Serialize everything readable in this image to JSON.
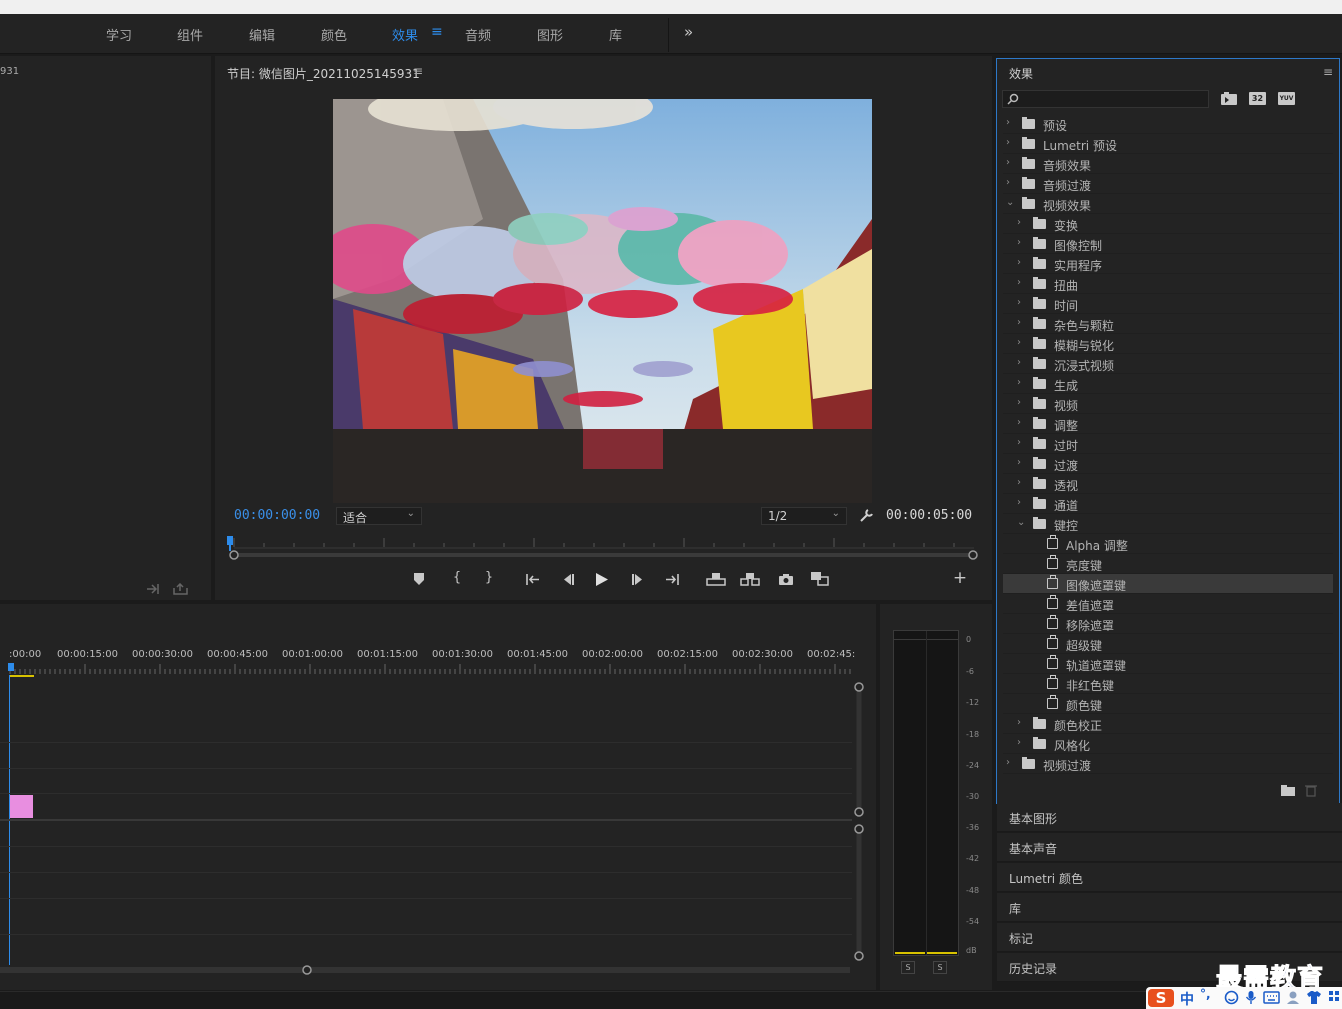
{
  "workspaces": {
    "items": [
      "学习",
      "组件",
      "编辑",
      "颜色",
      "效果",
      "音频",
      "图形",
      "库"
    ],
    "active_index": 4,
    "overflow": "»",
    "active_menu_glyph": "≡"
  },
  "source_panel": {
    "title_fragment": "931"
  },
  "program_monitor": {
    "title": "节目: 微信图片_20211025145931",
    "menu_glyph": "≡",
    "current_timecode": "00:00:00:00",
    "fit_select": "适合",
    "resolution_select": "1/2",
    "duration_timecode": "00:00:05:00",
    "add_glyph": "+"
  },
  "timeline": {
    "ruler_labels": [
      ":00:00",
      "00:00:15:00",
      "00:00:30:00",
      "00:00:45:00",
      "00:01:00:00",
      "00:01:15:00",
      "00:01:30:00",
      "00:01:45:00",
      "00:02:00:00",
      "00:02:15:00",
      "00:02:30:00",
      "00:02:45:"
    ]
  },
  "audio_meter": {
    "db_labels": [
      "0",
      "-6",
      "-12",
      "-18",
      "-24",
      "-30",
      "-36",
      "-42",
      "-48",
      "-54",
      "dB"
    ],
    "solo_labels": [
      "S",
      "S"
    ]
  },
  "effects_panel": {
    "title": "效果",
    "menu_glyph": "≡",
    "search_value": "",
    "badges": [
      "32",
      "YUV"
    ],
    "tree": [
      {
        "label": "预设",
        "level": 0,
        "expanded": false,
        "kind": "preset-folder"
      },
      {
        "label": "Lumetri 预设",
        "level": 0,
        "expanded": false,
        "kind": "preset-folder"
      },
      {
        "label": "音频效果",
        "level": 0,
        "expanded": false,
        "kind": "folder"
      },
      {
        "label": "音频过渡",
        "level": 0,
        "expanded": false,
        "kind": "folder"
      },
      {
        "label": "视频效果",
        "level": 0,
        "expanded": true,
        "kind": "folder"
      },
      {
        "label": "变换",
        "level": 1,
        "expanded": false,
        "kind": "folder"
      },
      {
        "label": "图像控制",
        "level": 1,
        "expanded": false,
        "kind": "folder"
      },
      {
        "label": "实用程序",
        "level": 1,
        "expanded": false,
        "kind": "folder"
      },
      {
        "label": "扭曲",
        "level": 1,
        "expanded": false,
        "kind": "folder"
      },
      {
        "label": "时间",
        "level": 1,
        "expanded": false,
        "kind": "folder"
      },
      {
        "label": "杂色与颗粒",
        "level": 1,
        "expanded": false,
        "kind": "folder"
      },
      {
        "label": "模糊与锐化",
        "level": 1,
        "expanded": false,
        "kind": "folder"
      },
      {
        "label": "沉浸式视频",
        "level": 1,
        "expanded": false,
        "kind": "folder"
      },
      {
        "label": "生成",
        "level": 1,
        "expanded": false,
        "kind": "folder"
      },
      {
        "label": "视频",
        "level": 1,
        "expanded": false,
        "kind": "folder"
      },
      {
        "label": "调整",
        "level": 1,
        "expanded": false,
        "kind": "folder"
      },
      {
        "label": "过时",
        "level": 1,
        "expanded": false,
        "kind": "folder"
      },
      {
        "label": "过渡",
        "level": 1,
        "expanded": false,
        "kind": "folder"
      },
      {
        "label": "透视",
        "level": 1,
        "expanded": false,
        "kind": "folder"
      },
      {
        "label": "通道",
        "level": 1,
        "expanded": false,
        "kind": "folder"
      },
      {
        "label": "键控",
        "level": 1,
        "expanded": true,
        "kind": "folder"
      },
      {
        "label": "Alpha 调整",
        "level": 2,
        "kind": "effect"
      },
      {
        "label": "亮度键",
        "level": 2,
        "kind": "effect"
      },
      {
        "label": "图像遮罩键",
        "level": 2,
        "kind": "effect",
        "selected": true
      },
      {
        "label": "差值遮罩",
        "level": 2,
        "kind": "effect"
      },
      {
        "label": "移除遮罩",
        "level": 2,
        "kind": "effect"
      },
      {
        "label": "超级键",
        "level": 2,
        "kind": "effect"
      },
      {
        "label": "轨道遮罩键",
        "level": 2,
        "kind": "effect"
      },
      {
        "label": "非红色键",
        "level": 2,
        "kind": "effect"
      },
      {
        "label": "颜色键",
        "level": 2,
        "kind": "effect"
      },
      {
        "label": "颜色校正",
        "level": 1,
        "expanded": false,
        "kind": "folder"
      },
      {
        "label": "风格化",
        "level": 1,
        "expanded": false,
        "kind": "folder"
      },
      {
        "label": "视频过渡",
        "level": 0,
        "expanded": false,
        "kind": "folder"
      }
    ]
  },
  "collapsed_panels": [
    "基本图形",
    "基本声音",
    "Lumetri 颜色",
    "库",
    "标记",
    "历史记录"
  ],
  "watermark": {
    "text": "最需教育",
    "ime_text": "中",
    "ime_punct": "°,"
  },
  "colors": {
    "accent_blue": "#2d8ceb",
    "clip_pink": "#e88ee0",
    "meter_yellow": "#d8c200",
    "watermark_blue": "#1a3fa8"
  }
}
